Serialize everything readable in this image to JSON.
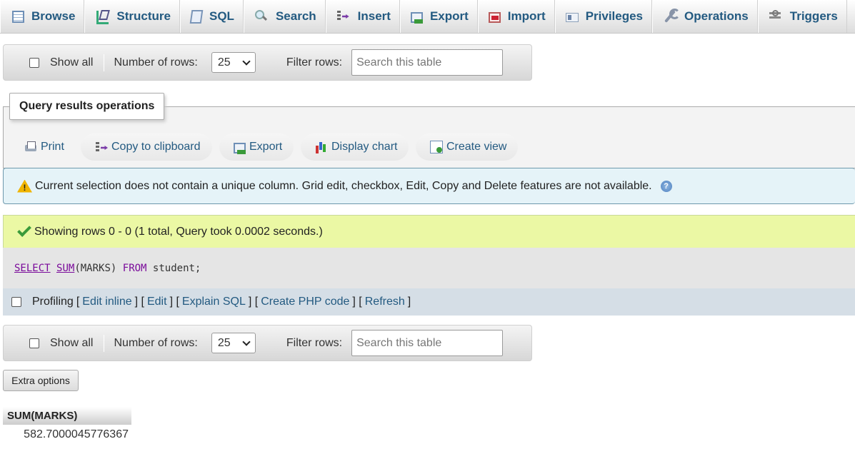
{
  "tabs": [
    {
      "label": "Browse",
      "icon": "browse-icon"
    },
    {
      "label": "Structure",
      "icon": "structure-icon"
    },
    {
      "label": "SQL",
      "icon": "sql-icon"
    },
    {
      "label": "Search",
      "icon": "search-icon"
    },
    {
      "label": "Insert",
      "icon": "insert-icon"
    },
    {
      "label": "Export",
      "icon": "export-icon"
    },
    {
      "label": "Import",
      "icon": "import-icon"
    },
    {
      "label": "Privileges",
      "icon": "privileges-icon"
    },
    {
      "label": "Operations",
      "icon": "operations-icon"
    },
    {
      "label": "Triggers",
      "icon": "triggers-icon"
    }
  ],
  "nav_top": {
    "show_all": "Show all",
    "rows_label": "Number of rows:",
    "rows_value": "25",
    "filter_label": "Filter rows:",
    "filter_placeholder": "Search this table"
  },
  "nav_bottom": {
    "show_all": "Show all",
    "rows_label": "Number of rows:",
    "rows_value": "25",
    "filter_label": "Filter rows:",
    "filter_placeholder": "Search this table"
  },
  "query_ops": {
    "legend": "Query results operations",
    "print": "Print",
    "copy": "Copy to clipboard",
    "export": "Export",
    "chart": "Display chart",
    "create_view": "Create view"
  },
  "notice": {
    "text": "Current selection does not contain a unique column. Grid edit, checkbox, Edit, Copy and Delete features are not available."
  },
  "success": {
    "text": "Showing rows 0 - 0 (1 total, Query took 0.0002 seconds.)"
  },
  "sql": {
    "select": "SELECT",
    "sum": "SUM",
    "arg": "(MARKS)",
    "from": "FROM",
    "rest": "student;"
  },
  "profiling": {
    "label": "Profiling",
    "edit_inline": "Edit inline",
    "edit": "Edit",
    "explain": "Explain SQL",
    "php": "Create PHP code",
    "refresh": "Refresh"
  },
  "extra_options": "Extra options",
  "result": {
    "column": "SUM(MARKS)",
    "value": "582.7000045776367"
  },
  "colors": {
    "link": "#235a81",
    "success_bg": "#ebf8a4",
    "notice_bg": "#e5f3f8",
    "sql_keyword": "#7a0a9a"
  }
}
